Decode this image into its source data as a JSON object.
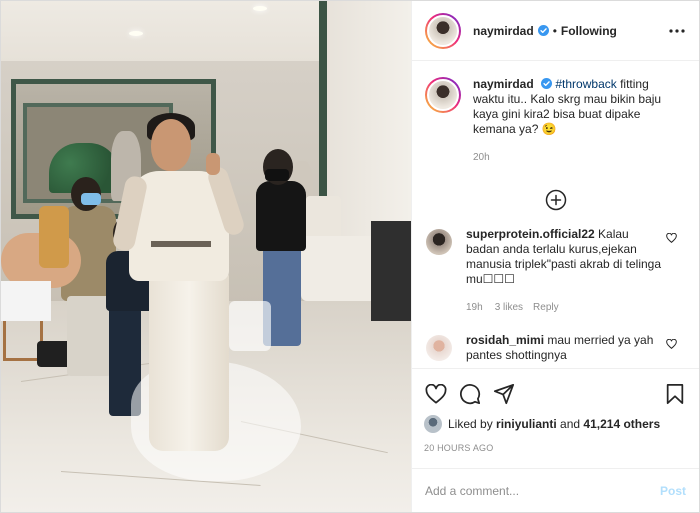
{
  "header": {
    "username": "naymirdad",
    "separator": "•",
    "follow_status": "Following",
    "more_icon": "more-horizontal-icon"
  },
  "caption": {
    "username": "naymirdad",
    "hashtag": "#throwback",
    "text": " fitting waktu itu.. Kalo skrg mau bikin baju kaya gini kira2 bisa buat dipake kemana ya? 😉",
    "time": "20h"
  },
  "load_more_icon": "plus-circle-icon",
  "comments": [
    {
      "username": "superprotein.official22",
      "text": " Kalau badan anda terlalu kurus,ejekan manusia triplek\"pasti akrab di telinga mu☐☐☐",
      "time": "19h",
      "likes": "3 likes",
      "reply": "Reply"
    },
    {
      "username": "rosidah_mimi",
      "text": " mau merried ya yah pantes shottingnya",
      "time": "",
      "likes": "",
      "reply": ""
    }
  ],
  "actions": {
    "icons": [
      "heart-icon",
      "comment-icon",
      "share-icon",
      "bookmark-icon"
    ],
    "liked_by_prefix": "Liked by ",
    "liked_by_user": "riniyulianti",
    "liked_by_and": " and ",
    "liked_by_count": "41,214 others",
    "timestamp": "20 HOURS AGO"
  },
  "comment_box": {
    "placeholder": "Add a comment...",
    "post_label": "Post"
  },
  "colors": {
    "link_blue": "#00376b",
    "verified_blue": "#3897f0",
    "muted": "#8e8e8e",
    "post_disabled": "#b2dffc"
  }
}
